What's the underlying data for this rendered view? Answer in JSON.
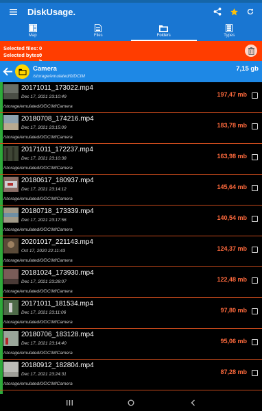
{
  "app": {
    "title": "DiskUsage."
  },
  "tabs": [
    {
      "label": "Map",
      "icon": "map-icon",
      "active": false
    },
    {
      "label": "Files",
      "icon": "file-icon",
      "active": false
    },
    {
      "label": "Folders",
      "icon": "folder-icon",
      "active": true
    },
    {
      "label": "Types",
      "icon": "types-icon",
      "active": false
    }
  ],
  "selection": {
    "files_label": "Selected files:",
    "files_value": "0",
    "bytes_label": "Selected bytes:",
    "bytes_value": "0 b"
  },
  "folder": {
    "name": "Camera",
    "path": "/storage/emulated/0/DCIM",
    "size": "7,15 gb"
  },
  "files": [
    {
      "name": "20171011_173022.mp4",
      "date": "Dec 17, 2021 23:10:49",
      "path": "/storage/emulated/0/DCIM/Camera",
      "size": "197,47 mb",
      "thumb": "#6a6f66"
    },
    {
      "name": "20180708_174216.mp4",
      "date": "Dec 17, 2021 23:15:09",
      "path": "/storage/emulated/0/DCIM/Camera",
      "size": "183,78 mb",
      "thumb": "#8ea3b0"
    },
    {
      "name": "20171011_172237.mp4",
      "date": "Dec 17, 2021 23:10:38",
      "path": "/storage/emulated/0/DCIM/Camera",
      "size": "163,98 mb",
      "thumb": "#3e4535"
    },
    {
      "name": "20180617_180937.mp4",
      "date": "Dec 17, 2021 23:14:12",
      "path": "/storage/emulated/0/DCIM/Camera",
      "size": "145,64 mb",
      "thumb": "#8b6e66"
    },
    {
      "name": "20180718_173339.mp4",
      "date": "Dec 17, 2021 23:17:56",
      "path": "/storage/emulated/0/DCIM/Camera",
      "size": "140,54 mb",
      "thumb": "#a19a88"
    },
    {
      "name": "20201017_221143.mp4",
      "date": "Oct 17, 2020 22:11:43",
      "path": "/storage/emulated/0/DCIM/Camera",
      "size": "124,37 mb",
      "thumb": "#5a4a38"
    },
    {
      "name": "20181024_173930.mp4",
      "date": "Dec 17, 2021 23:28:07",
      "path": "/storage/emulated/0/DCIM/Camera",
      "size": "122,48 mb",
      "thumb": "#7a5c58"
    },
    {
      "name": "20171011_181534.mp4",
      "date": "Dec 17, 2021 23:11:06",
      "path": "/storage/emulated/0/DCIM/Camera",
      "size": "97,80 mb",
      "thumb": "#4e6a48"
    },
    {
      "name": "20180706_183128.mp4",
      "date": "Dec 17, 2021 23:14:40",
      "path": "/storage/emulated/0/DCIM/Camera",
      "size": "95,06 mb",
      "thumb": "#9aa69a"
    },
    {
      "name": "20180912_182804.mp4",
      "date": "Dec 17, 2021 23:24:31",
      "path": "/storage/emulated/0/DCIM/Camera",
      "size": "87,28 mb",
      "thumb": "#bdbdb8"
    }
  ],
  "colors": {
    "accent": "#1976d2",
    "selection_bar": "#ff3d00",
    "size_text": "#ff6a3d",
    "usage_bar": "#2eaa3a"
  }
}
